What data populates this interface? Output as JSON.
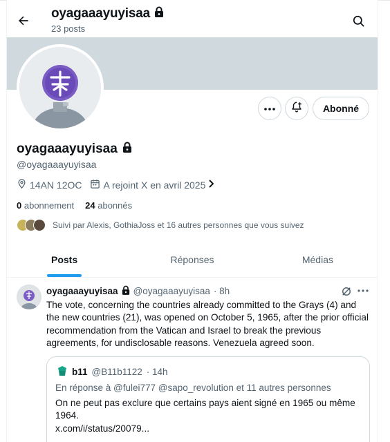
{
  "header": {
    "title": "oyagaaayuyisaa",
    "posts_count": "23 posts"
  },
  "profile": {
    "name": "oyagaaayuyisaa",
    "handle": "@oyagaaayuyisaa",
    "location": "14AN 12OC",
    "joined": "A rejoint X en avril 2025",
    "following_count": "0",
    "following_label": "abonnement",
    "followers_count": "24",
    "followers_label": "abonnés",
    "followed_by": "Suivi par Alexis, GothiaJoss et 16 autres personnes que vous suivez",
    "follow_button": "Abonné"
  },
  "tabs": [
    {
      "label": "Posts",
      "active": true
    },
    {
      "label": "Réponses",
      "active": false
    },
    {
      "label": "Médias",
      "active": false
    }
  ],
  "post": {
    "author": "oyagaaayuyisaa",
    "handle": "@oyagaaayuyisaa",
    "time": "· 8h",
    "text": "The vote, concerning the countries already committed to the Grays (4) and the new countries (21), was opened on October 5, 1965, after the prior official recommendation from the Vatican and Israel to break the previous agreements, for undisclosable reasons. Venezuela agreed soon.",
    "quote": {
      "author": "b11",
      "handle": "@B11b1122",
      "time": "· 14h",
      "reply_to": "En réponse à @fulei777 @sapo_revolution  et 11 autres personnes",
      "text": "On ne peut pas exclure que certains pays aient signé en 1965 ou même 1964.",
      "link": "x.com/i/status/20079..."
    }
  },
  "colors": {
    "accent": "#1d9bf0",
    "banner": "#cfd9de",
    "avatar_bg": "#8a96a1",
    "avatar_symbol": "#7b5cc4",
    "text_secondary": "#536471"
  },
  "icons": [
    "back-arrow-icon",
    "lock-icon",
    "search-icon",
    "more-icon",
    "notification-add-icon",
    "location-icon",
    "calendar-icon",
    "chevron-right-icon",
    "grok-icon",
    "b11-avatar-icon"
  ]
}
